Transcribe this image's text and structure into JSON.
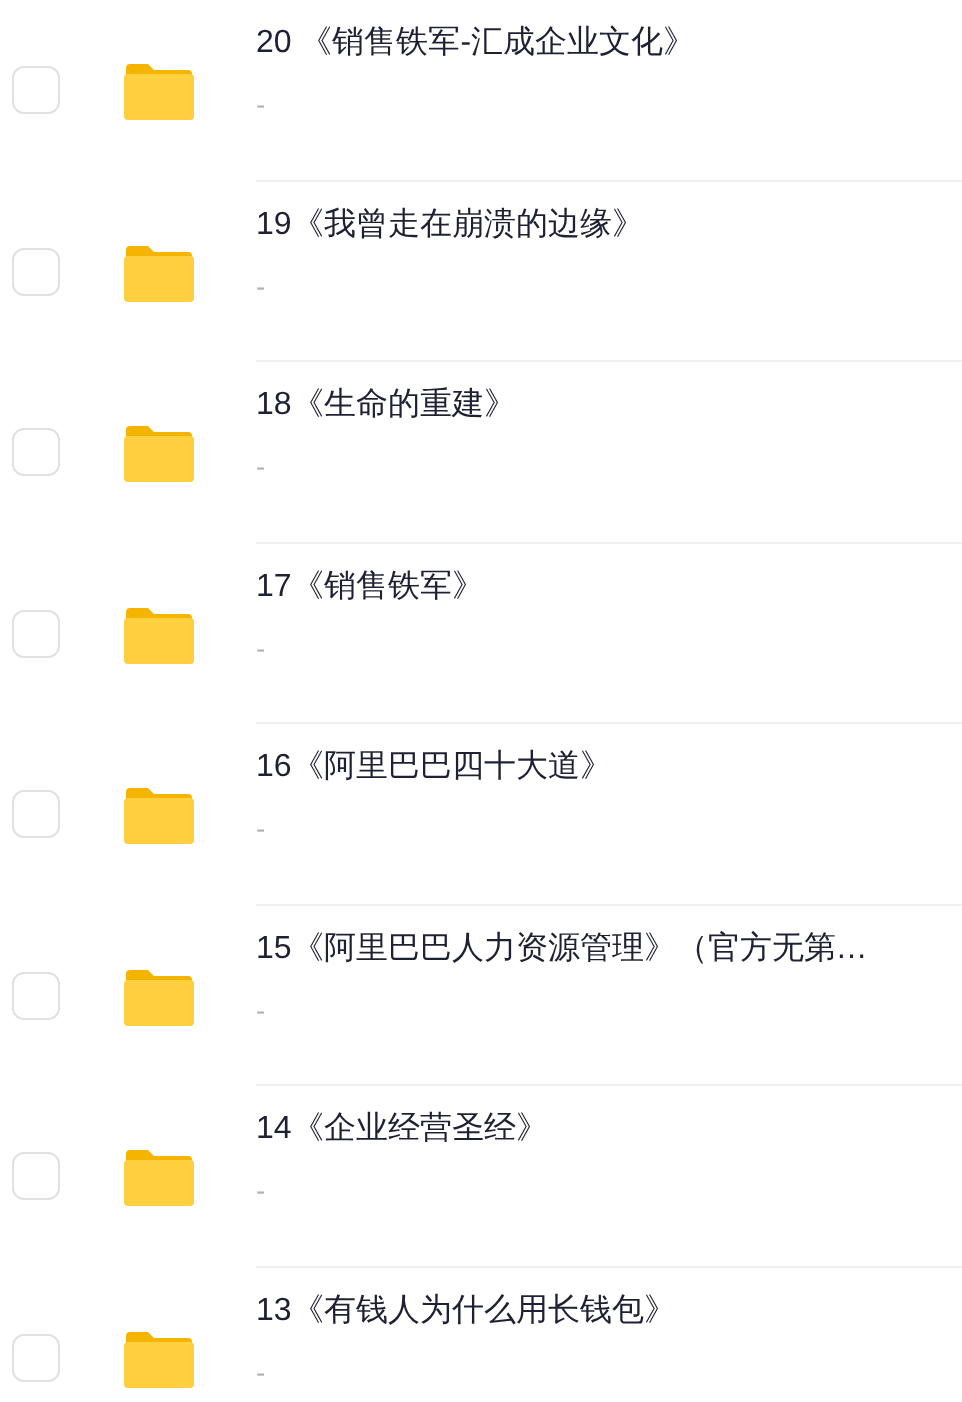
{
  "files": [
    {
      "name": "20 《销售铁军-汇成企业文化》",
      "detail": "-",
      "selected": false
    },
    {
      "name": "19《我曾走在崩溃的边缘》",
      "detail": "-",
      "selected": false
    },
    {
      "name": "18《生命的重建》",
      "detail": "-",
      "selected": false
    },
    {
      "name": "17《销售铁军》",
      "detail": "-",
      "selected": false
    },
    {
      "name": "16《阿里巴巴四十大道》",
      "detail": "-",
      "selected": false
    },
    {
      "name": "15《阿里巴巴人力资源管理》（官方无第…",
      "detail": "-",
      "selected": false
    },
    {
      "name": "14《企业经营圣经》",
      "detail": "-",
      "selected": false
    },
    {
      "name": "13《有钱人为什么用长钱包》",
      "detail": "-",
      "selected": false
    }
  ]
}
